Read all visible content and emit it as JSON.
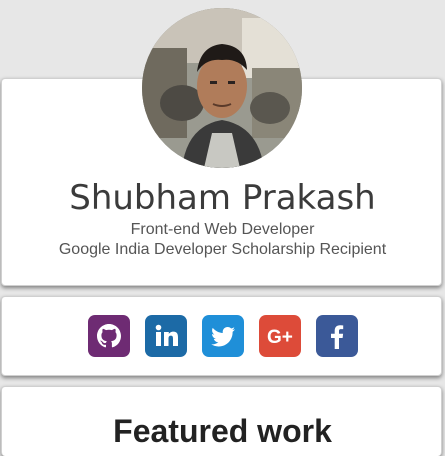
{
  "profile": {
    "name": "Shubham Prakash",
    "role": "Front-end Web Developer",
    "achievement": "Google India Developer Scholarship Recipient",
    "avatar_icon": "profile-photo"
  },
  "social": {
    "links": [
      {
        "icon": "github-icon",
        "color": "#6e2b73"
      },
      {
        "icon": "linkedin-icon",
        "color": "#1c6aa6"
      },
      {
        "icon": "twitter-icon",
        "color": "#1f8fd8"
      },
      {
        "icon": "google-plus-icon",
        "color": "#dd4b39"
      },
      {
        "icon": "facebook-icon",
        "color": "#3b5998"
      }
    ]
  },
  "featured": {
    "title": "Featured work"
  }
}
